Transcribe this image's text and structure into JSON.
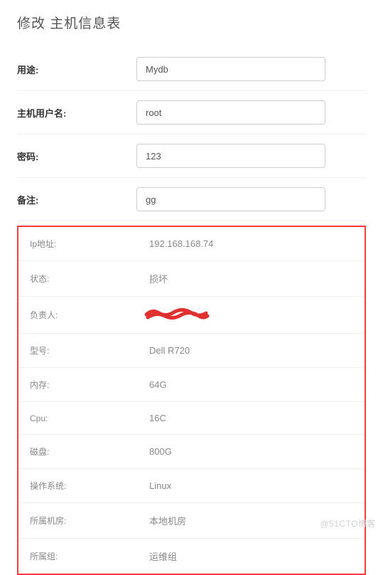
{
  "page": {
    "title": "修改 主机信息表"
  },
  "form": {
    "purpose": {
      "label": "用途:",
      "value": "Mydb"
    },
    "hostuser": {
      "label": "主机用户名:",
      "value": "root"
    },
    "password": {
      "label": "密码:",
      "value": "123"
    },
    "remark": {
      "label": "备注:",
      "value": "gg"
    }
  },
  "readonly": {
    "ip": {
      "label": "Ip地址:",
      "value": "192.168.168.74"
    },
    "status": {
      "label": "状态:",
      "value": "损坏"
    },
    "owner": {
      "label": "负责人:",
      "value": ""
    },
    "model": {
      "label": "型号:",
      "value": "Dell R720"
    },
    "memory": {
      "label": "内存:",
      "value": "64G"
    },
    "cpu": {
      "label": "Cpu:",
      "value": "16C"
    },
    "disk": {
      "label": "磁盘:",
      "value": "800G"
    },
    "os": {
      "label": "操作系统:",
      "value": "Linux"
    },
    "room": {
      "label": "所属机房:",
      "value": "本地机房"
    },
    "group": {
      "label": "所属组:",
      "value": "运维组"
    }
  },
  "watermark": "@51CTO博客"
}
